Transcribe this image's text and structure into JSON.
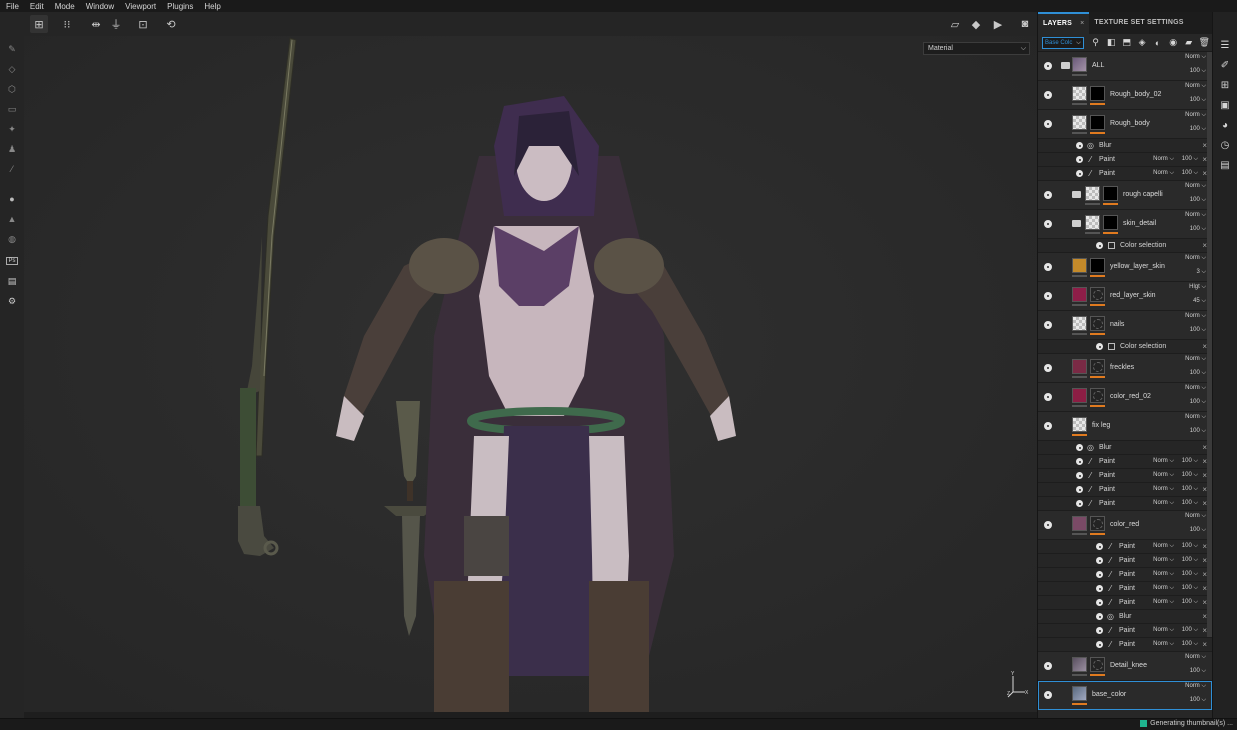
{
  "menu": [
    "File",
    "Edit",
    "Mode",
    "Window",
    "Viewport",
    "Plugins",
    "Help"
  ],
  "viewport": {
    "material_mode": "Material",
    "axis": {
      "y": "Y",
      "z": "Z",
      "x": "X"
    }
  },
  "panel": {
    "tabs": [
      "LAYERS",
      "TEXTURE SET SETTINGS"
    ],
    "close_glyph": "×",
    "channel": "Base Colc"
  },
  "layers": [
    {
      "type": "layer",
      "name": "ALL",
      "blend": "Norm",
      "opacity": "100",
      "folder": true
    },
    {
      "type": "layer",
      "name": "Rough_body_02",
      "blend": "Norm",
      "opacity": "100"
    },
    {
      "type": "layer",
      "name": "Rough_body",
      "blend": "Norm",
      "opacity": "100"
    },
    {
      "type": "effect",
      "name": "Blur"
    },
    {
      "type": "effect",
      "name": "Paint",
      "blend": "Norm",
      "opacity": "100"
    },
    {
      "type": "effect",
      "name": "Paint",
      "blend": "Norm",
      "opacity": "100"
    },
    {
      "type": "layer",
      "name": "rough capelli",
      "blend": "Norm",
      "opacity": "100",
      "folder": true
    },
    {
      "type": "layer",
      "name": "skin_detail",
      "blend": "Norm",
      "opacity": "100",
      "folder": true
    },
    {
      "type": "effect",
      "name": "Color selection",
      "checkbox": true
    },
    {
      "type": "layer",
      "name": "yellow_layer_skin",
      "blend": "Norm",
      "opacity": "3"
    },
    {
      "type": "layer",
      "name": "red_layer_skin",
      "blend": "Hlgt",
      "opacity": "45"
    },
    {
      "type": "layer",
      "name": "nails",
      "blend": "Norm",
      "opacity": "100"
    },
    {
      "type": "effect",
      "name": "Color selection",
      "checkbox": true
    },
    {
      "type": "layer",
      "name": "freckles",
      "blend": "Norm",
      "opacity": "100"
    },
    {
      "type": "layer",
      "name": "color_red_02",
      "blend": "Norm",
      "opacity": "100"
    },
    {
      "type": "layer",
      "name": "fix leg",
      "blend": "Norm",
      "opacity": "100"
    },
    {
      "type": "effect",
      "name": "Blur"
    },
    {
      "type": "effect",
      "name": "Paint",
      "blend": "Norm",
      "opacity": "100"
    },
    {
      "type": "effect",
      "name": "Paint",
      "blend": "Norm",
      "opacity": "100"
    },
    {
      "type": "effect",
      "name": "Paint",
      "blend": "Norm",
      "opacity": "100"
    },
    {
      "type": "effect",
      "name": "Paint",
      "blend": "Norm",
      "opacity": "100"
    },
    {
      "type": "layer",
      "name": "color_red",
      "blend": "Norm",
      "opacity": "100"
    },
    {
      "type": "effect",
      "name": "Paint",
      "blend": "Norm",
      "opacity": "100"
    },
    {
      "type": "effect",
      "name": "Paint",
      "blend": "Norm",
      "opacity": "100"
    },
    {
      "type": "effect",
      "name": "Paint",
      "blend": "Norm",
      "opacity": "100"
    },
    {
      "type": "effect",
      "name": "Paint",
      "blend": "Norm",
      "opacity": "100"
    },
    {
      "type": "effect",
      "name": "Paint",
      "blend": "Norm",
      "opacity": "100"
    },
    {
      "type": "effect",
      "name": "Blur"
    },
    {
      "type": "effect",
      "name": "Paint",
      "blend": "Norm",
      "opacity": "100"
    },
    {
      "type": "effect",
      "name": "Paint",
      "blend": "Norm",
      "opacity": "100"
    },
    {
      "type": "layer",
      "name": "Detail_knee",
      "blend": "Norm",
      "opacity": "100"
    },
    {
      "type": "layer",
      "name": "base_color",
      "blend": "Norm",
      "opacity": "100",
      "selected": true
    }
  ],
  "status": {
    "text": "Generating thumbnail(s) ..."
  }
}
